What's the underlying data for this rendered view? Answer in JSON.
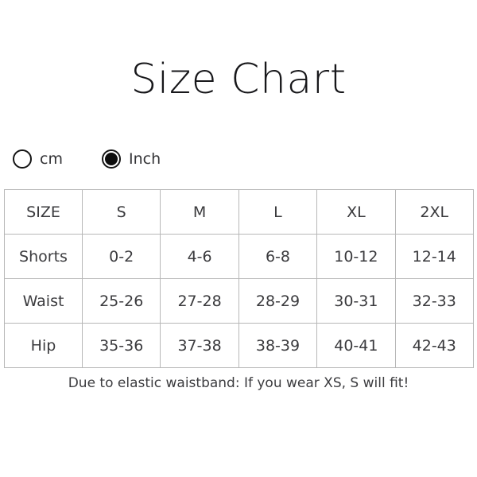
{
  "page": {
    "title": "Size Chart",
    "background_color": "#ffffff",
    "text_color": "#333336",
    "border_color": "#b7b7b7"
  },
  "units": {
    "selected": "Inch",
    "options": [
      {
        "label": "cm",
        "selected": false,
        "icon": "radio-unchecked-icon"
      },
      {
        "label": "Inch",
        "selected": true,
        "icon": "radio-checked-icon"
      }
    ]
  },
  "table": {
    "headers": [
      "SIZE",
      "S",
      "M",
      "L",
      "XL",
      "2XL"
    ],
    "rows": [
      {
        "label": "Shorts",
        "values": [
          "0-2",
          "4-6",
          "6-8",
          "10-12",
          "12-14"
        ]
      },
      {
        "label": "Waist",
        "values": [
          "25-26",
          "27-28",
          "28-29",
          "30-31",
          "32-33"
        ]
      },
      {
        "label": "Hip",
        "values": [
          "35-36",
          "37-38",
          "38-39",
          "40-41",
          "42-43"
        ]
      }
    ]
  },
  "note": "Due to elastic waistband: If you wear XS, S will fit!"
}
